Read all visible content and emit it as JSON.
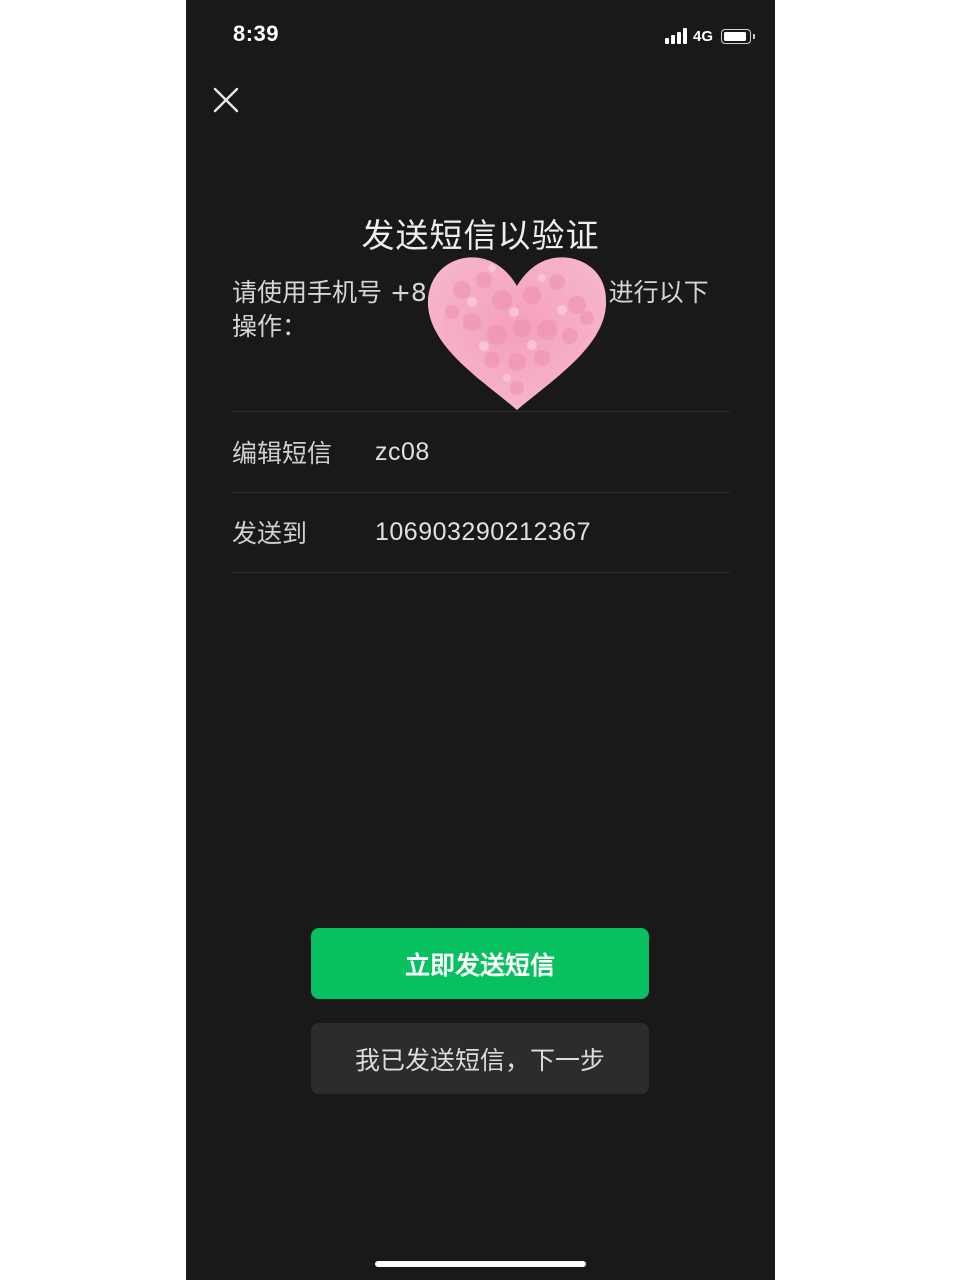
{
  "status_bar": {
    "time": "8:39",
    "network": "4G",
    "signal_icon": "cellular-signal-icon",
    "battery_icon": "battery-icon"
  },
  "nav": {
    "close_icon": "close-icon"
  },
  "title": "发送短信以验证",
  "instruction": {
    "prefix": "请使用手机号 +8",
    "suffix": "5 进行以下",
    "line2": "操作："
  },
  "fields": [
    {
      "label": "编辑短信",
      "value": "zc08"
    },
    {
      "label": "发送到",
      "value": "106903290212367"
    }
  ],
  "buttons": {
    "send_now": "立即发送短信",
    "already_sent": "我已发送短信，下一步"
  },
  "colors": {
    "background": "#191919",
    "primary_green": "#07c160",
    "secondary_button": "#2c2c2c",
    "heart_sticker": "#f6a9c4"
  }
}
